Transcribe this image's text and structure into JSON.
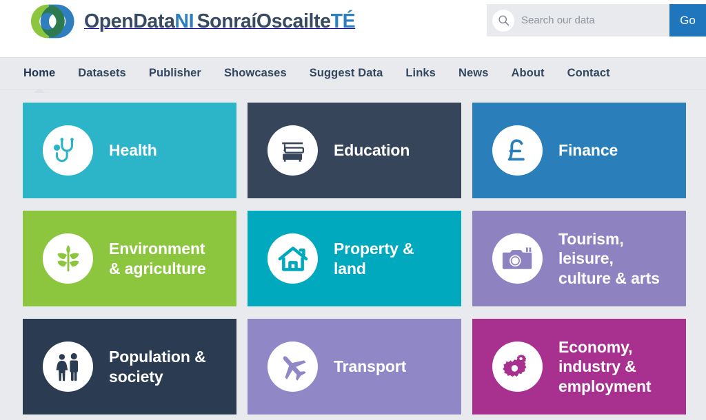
{
  "header": {
    "logo": {
      "line1_main": "OpenData",
      "line1_accent": "NI",
      "line2_main": "SonraíOscailte",
      "line2_accent": "TÉ",
      "icon_name": "opendata-ni-logo",
      "green": "#8cc63f",
      "blue": "#2f7fbf",
      "dark_green": "#2d7a4f"
    },
    "search": {
      "placeholder": "Search our data",
      "value": "",
      "button_label": "Go",
      "icon_name": "search-icon",
      "button_color": "#1f76bd",
      "field_bg": "#e8eaed"
    }
  },
  "nav": {
    "items": [
      {
        "label": "Home",
        "active": true
      },
      {
        "label": "Datasets",
        "active": false
      },
      {
        "label": "Publisher",
        "active": false
      },
      {
        "label": "Showcases",
        "active": false
      },
      {
        "label": "Suggest Data",
        "active": false
      },
      {
        "label": "Links",
        "active": false
      },
      {
        "label": "News",
        "active": false
      },
      {
        "label": "About",
        "active": false
      },
      {
        "label": "Contact",
        "active": false
      }
    ]
  },
  "categories": [
    {
      "id": "health",
      "lines": [
        "Health"
      ],
      "color": "#2cb4c8",
      "icon_name": "stethoscope-icon"
    },
    {
      "id": "education",
      "lines": [
        "Education"
      ],
      "color": "#36455a",
      "icon_name": "books-graduation-cap-icon"
    },
    {
      "id": "finance",
      "lines": [
        "Finance"
      ],
      "color": "#2a7fba",
      "icon_name": "pound-sterling-icon"
    },
    {
      "id": "environment-agriculture",
      "lines": [
        "Environment",
        "& agriculture"
      ],
      "color": "#8cc63f",
      "icon_name": "plant-leaf-icon"
    },
    {
      "id": "property-land",
      "lines": [
        "Property &",
        "land"
      ],
      "color": "#00a9bd",
      "icon_name": "house-icon"
    },
    {
      "id": "tourism-leisure-culture-arts",
      "lines": [
        "Tourism,",
        "leisure,",
        "culture & arts"
      ],
      "color": "#8e83c0",
      "icon_name": "camera-icon"
    },
    {
      "id": "population-society",
      "lines": [
        "Population &",
        "society"
      ],
      "color": "#2a3b52",
      "icon_name": "people-icon"
    },
    {
      "id": "transport",
      "lines": [
        "Transport"
      ],
      "color": "#9087c6",
      "icon_name": "airplane-icon"
    },
    {
      "id": "economy-industry-employment",
      "lines": [
        "Economy,",
        "industry &",
        "employment"
      ],
      "color": "#a8308f",
      "icon_name": "gears-icon"
    }
  ],
  "page": {
    "background": "#e8eaed"
  }
}
